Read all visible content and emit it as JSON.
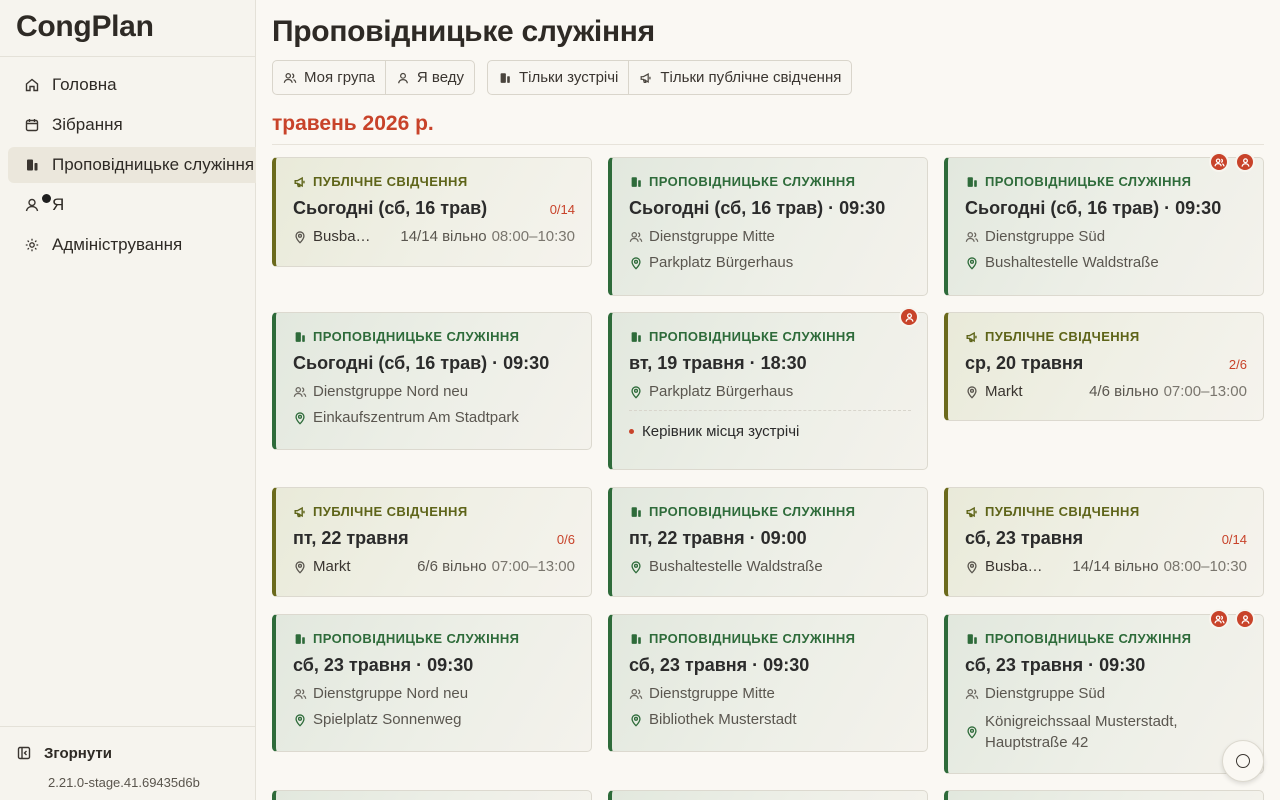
{
  "app": {
    "brand": "CongPlan",
    "version": "2.21.0-stage.41.69435d6b"
  },
  "sidebar": {
    "items": [
      {
        "label": "Головна",
        "icon": "home-icon"
      },
      {
        "label": "Зібрання",
        "icon": "calendar-icon"
      },
      {
        "label": "Проповідницьке служіння",
        "icon": "ministry-icon",
        "active": true
      },
      {
        "label": "Я",
        "icon": "user-icon"
      },
      {
        "label": "Адміністрування",
        "icon": "gear-icon"
      }
    ],
    "collapse_label": "Згорнути"
  },
  "page": {
    "title": "Проповідницьке служіння",
    "month": "травень 2026 р."
  },
  "filters": {
    "my_group": "Моя група",
    "i_lead": "Я веду",
    "meetings_only": "Тільки зустрічі",
    "public_only": "Тільки публічне свідчення"
  },
  "labels": {
    "service": "Проповідницьке служіння",
    "public": "Публічне свідчення"
  },
  "cards": [
    {
      "type": "public",
      "title": "Сьогодні (сб, 16 трав)",
      "count": "0/14",
      "location": "Busbahnhof",
      "available": "14/14 вільно",
      "time": "08:00–10:30"
    },
    {
      "type": "service",
      "title": "Сьогодні (сб, 16 трав) · 09:30",
      "group": "Dienstgruppe Mitte",
      "location": "Parkplatz Bürgerhaus"
    },
    {
      "type": "service",
      "title": "Сьогодні (сб, 16 трав) · 09:30",
      "group": "Dienstgruppe Süd",
      "location": "Bushaltestelle Waldstraße"
    },
    {
      "type": "service",
      "title": "Сьогодні (сб, 16 трав) · 09:30",
      "group": "Dienstgruppe Nord neu",
      "location": "Einkaufszentrum Am Stadtpark"
    },
    {
      "type": "service",
      "title": "вт, 19 травня · 18:30",
      "location": "Parkplatz Bürgerhaus",
      "role": "Керівник місця зустрічі"
    },
    {
      "type": "public",
      "title": "ср, 20 травня",
      "count": "2/6",
      "location": "Markt",
      "available": "4/6 вільно",
      "time": "07:00–13:00"
    },
    {
      "type": "public",
      "title": "пт, 22 травня",
      "count": "0/6",
      "location": "Markt",
      "available": "6/6 вільно",
      "time": "07:00–13:00"
    },
    {
      "type": "service",
      "title": "пт, 22 травня · 09:00",
      "location": "Bushaltestelle Waldstraße"
    },
    {
      "type": "public",
      "title": "сб, 23 травня",
      "count": "0/14",
      "location": "Busbahnhof",
      "available": "14/14 вільно",
      "time": "08:00–10:30"
    },
    {
      "type": "service",
      "title": "сб, 23 травня · 09:30",
      "group": "Dienstgruppe Nord neu",
      "location": "Spielplatz Sonnenweg"
    },
    {
      "type": "service",
      "title": "сб, 23 травня · 09:30",
      "group": "Dienstgruppe Mitte",
      "location": "Bibliothek Musterstadt"
    },
    {
      "type": "service",
      "title": "сб, 23 травня · 09:30",
      "group": "Dienstgruppe Süd",
      "location": "Königreichssaal Musterstadt, Hauptstraße 42"
    }
  ],
  "colors": {
    "accent": "#c8432a",
    "service": "#2e6b3a",
    "public": "#6b6a1c"
  }
}
